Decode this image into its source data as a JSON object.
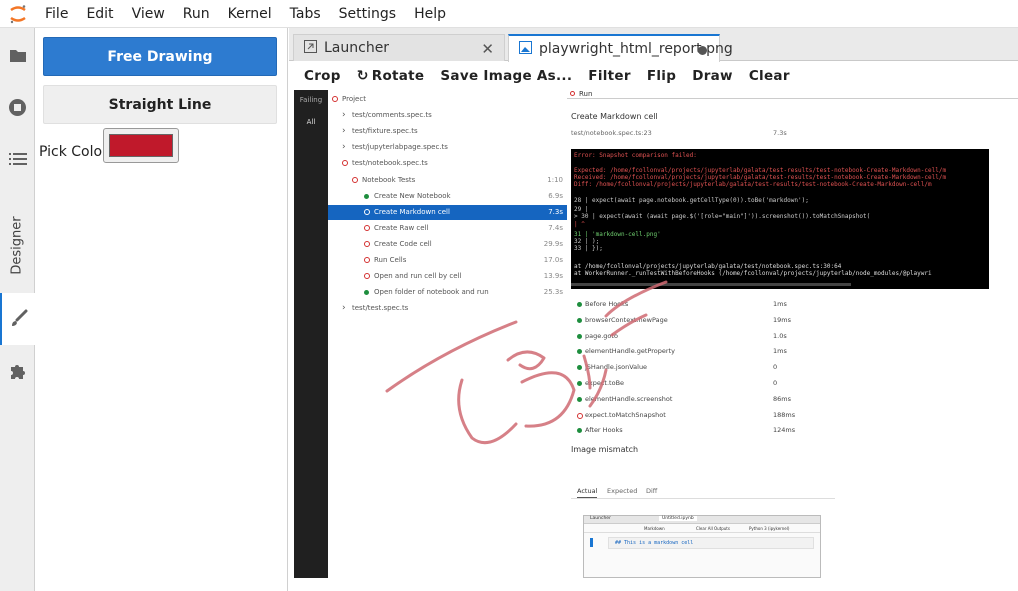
{
  "menubar": {
    "items": [
      "File",
      "Edit",
      "View",
      "Run",
      "Kernel",
      "Tabs",
      "Settings",
      "Help"
    ]
  },
  "sidebar": {
    "icons": [
      "folder-icon",
      "stop-circle-icon",
      "list-icon",
      "brush-icon",
      "puzzle-icon"
    ],
    "designer_label": "Designer"
  },
  "designer": {
    "free_drawing": "Free Drawing",
    "straight_line": "Straight Line",
    "pick_color_label": "Pick Color",
    "picked_color": "#c0192b"
  },
  "tabs": [
    {
      "label": "Launcher",
      "icon": "launcher-icon"
    },
    {
      "label": "playwright_html_report.png",
      "icon": "image-icon"
    }
  ],
  "toolbar": {
    "crop": "Crop",
    "rotate": "Rotate",
    "save": "Save Image As...",
    "filter": "Filter",
    "flip": "Flip",
    "draw": "Draw",
    "clear": "Clear"
  },
  "report": {
    "sidebar_labels": [
      "Failing",
      "All"
    ],
    "tree": [
      {
        "label": "Project",
        "dur": ""
      },
      {
        "label": "test/comments.spec.ts",
        "dur": ""
      },
      {
        "label": "test/fixture.spec.ts",
        "dur": ""
      },
      {
        "label": "test/jupyterlabpage.spec.ts",
        "dur": ""
      },
      {
        "label": "test/notebook.spec.ts",
        "dur": ""
      },
      {
        "label": "Notebook Tests",
        "dur": "1:10"
      },
      {
        "label": "Create New Notebook",
        "dur": "6.9s"
      },
      {
        "label": "Create Markdown cell",
        "dur": "7.3s"
      },
      {
        "label": "Create Raw cell",
        "dur": "7.4s"
      },
      {
        "label": "Create Code cell",
        "dur": "29.9s"
      },
      {
        "label": "Run Cells",
        "dur": "17.0s"
      },
      {
        "label": "Open and run cell by cell",
        "dur": "13.9s"
      },
      {
        "label": "Open folder of notebook and run",
        "dur": "25.3s"
      },
      {
        "label": "test/test.spec.ts",
        "dur": ""
      }
    ],
    "run_label": "Run",
    "test_title": "Create Markdown cell",
    "test_file": "test/notebook.spec.ts:23",
    "test_dur": "7.3s",
    "error_lines": [
      "Error: Snapshot comparison failed:",
      "Expected: /home/fcollonval/projects/jupyterlab/galata/test-results/test-notebook-Create-Markdown-cell/m",
      "Received: /home/fcollonval/projects/jupyterlab/galata/test-results/test-notebook-Create-Markdown-cell/m",
      "    Diff: /home/fcollonval/projects/jupyterlab/galata/test-results/test-notebook-Create-Markdown-cell/m",
      "  28 |     expect(await page.notebook.getCellType(0)).toBe('markdown');",
      "  29 |",
      "> 30 |     expect(await (await page.$('[role=\"main\"]')).screenshot()).toMatchSnapshot(",
      "     |                                                              ^",
      "  31 |       'markdown-cell.png'",
      "  32 |     );",
      "  33 |   });",
      "    at /home/fcollonval/projects/jupyterlab/galata/test/notebook.spec.ts:30:64",
      "    at WorkerRunner._runTestWithBeforeHooks (/home/fcollonval/projects/jupyterlab/node_modules/@playwri"
    ],
    "steps": [
      {
        "label": "Before Hooks",
        "dur": "1ms"
      },
      {
        "label": "browserContext.newPage",
        "dur": "19ms"
      },
      {
        "label": "page.goto",
        "dur": "1.0s"
      },
      {
        "label": "elementHandle.getProperty",
        "dur": "1ms"
      },
      {
        "label": "jSHandle.jsonValue",
        "dur": "0"
      },
      {
        "label": "expect.toBe",
        "dur": "0"
      },
      {
        "label": "elementHandle.screenshot",
        "dur": "86ms"
      },
      {
        "label": "expect.toMatchSnapshot",
        "dur": "188ms"
      },
      {
        "label": "After Hooks",
        "dur": "124ms"
      }
    ],
    "image_mismatch": "Image mismatch",
    "compare_tabs": [
      "Actual",
      "Expected",
      "Diff"
    ],
    "thumb_tabs": [
      "Launcher",
      "Untitled.ipynb"
    ],
    "thumb_cell_type": "Markdown",
    "thumb_text": "## This is a markdown cell",
    "thumb_kernel": "Python 3 (ipykernel)",
    "thumb_clear": "Clear All Outputs"
  },
  "drawing_color": "#d06a73"
}
